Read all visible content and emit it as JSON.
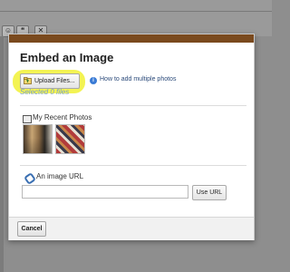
{
  "toolbar": {
    "buttons": [
      "☺",
      "❝",
      "✕"
    ]
  },
  "dialog": {
    "title": "Embed an Image",
    "upload_button": "Upload Files...",
    "selected_files": "Selected 0 files",
    "help_link": "How to add multiple photos",
    "recent_photos_label": "My Recent Photos",
    "image_url_label": "An image URL",
    "image_url_value": "",
    "use_url_button": "Use URL",
    "cancel_button": "Cancel"
  },
  "colors": {
    "dialog_topbar": "#7a4a1e",
    "highlight": "#f2f24a",
    "link_blue": "#3a7bd5"
  }
}
